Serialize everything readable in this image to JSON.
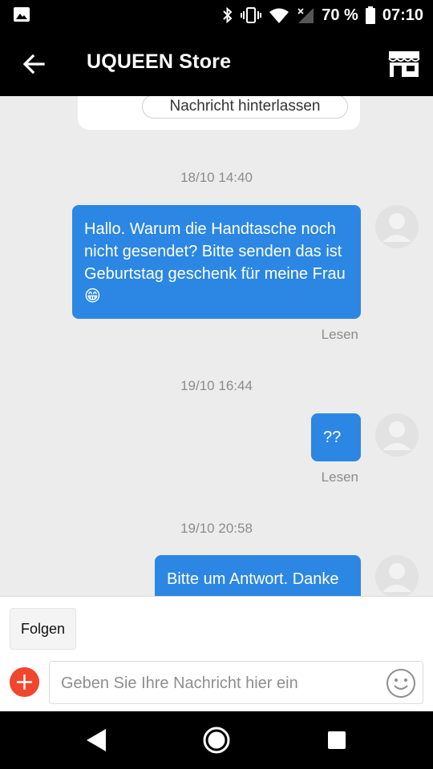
{
  "status_bar": {
    "battery": "70 %",
    "time": "07:10",
    "icons": [
      "image-icon",
      "bluetooth-icon",
      "vibrate-icon",
      "wifi-icon",
      "signal-icon",
      "battery-icon"
    ]
  },
  "app_bar": {
    "title": "UQUEEN Store",
    "back_icon": "arrow-left-icon",
    "store_icon": "store-icon"
  },
  "chat": {
    "leave_message_label": "Nachricht hinterlassen",
    "messages": [
      {
        "timestamp": "18/10 14:40",
        "text": "Hallo. Warum die Handtasche noch nicht gesendet? Bitte senden das ist Geburtstag geschenk für meine Frau 😁",
        "status": "Lesen"
      },
      {
        "timestamp": "19/10 16:44",
        "text": "??",
        "status": "Lesen"
      },
      {
        "timestamp": "19/10 20:58",
        "text": "Bitte um Antwort. Danke"
      }
    ]
  },
  "bottom_panel": {
    "follow_label": "Folgen",
    "input_placeholder": "Geben Sie Ihre Nachricht hier ein",
    "plus_icon": "plus-icon",
    "emoji_icon": "smiley-icon"
  },
  "nav_bar": {
    "icons": [
      "back-triangle-icon",
      "home-circle-icon",
      "recents-square-icon"
    ]
  },
  "colors": {
    "bubble": "#2b87e3",
    "chat_background": "#ececec",
    "plus_button": "#f0462d"
  }
}
